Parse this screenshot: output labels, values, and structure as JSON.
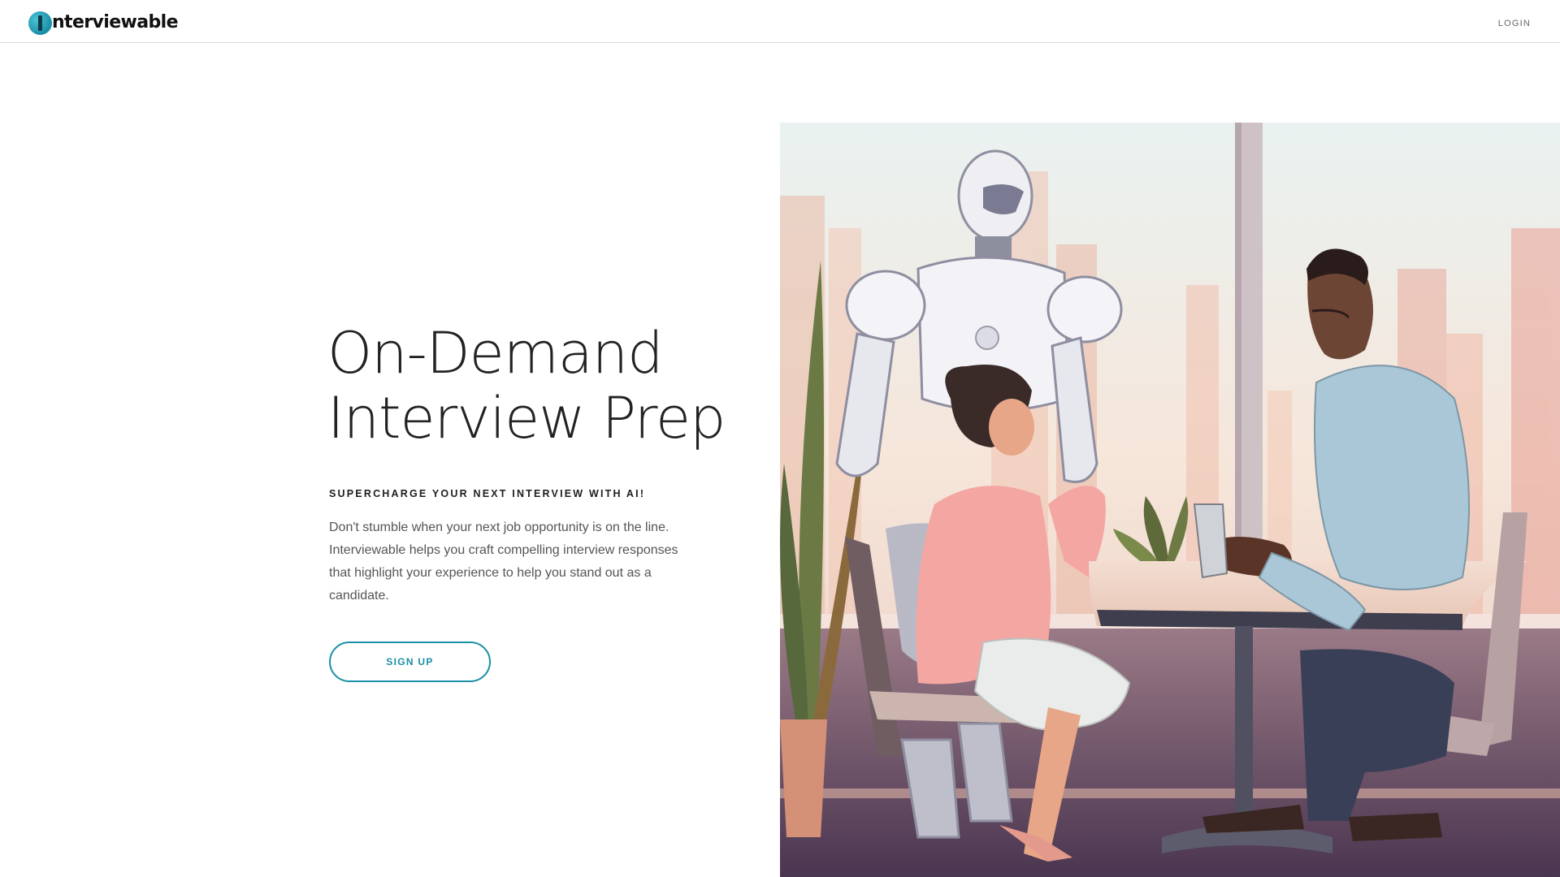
{
  "header": {
    "logo_text": "nterviewable",
    "login_label": "LOGIN"
  },
  "hero": {
    "title_line1": "On-Demand",
    "title_line2": "Interview Prep",
    "tagline": "SUPERCHARGE YOUR NEXT INTERVIEW WITH AI!",
    "description": "Don't stumble when your next job opportunity is on the line. Interviewable helps you craft compelling interview responses that highlight your experience to help you stand out as a candidate.",
    "signup_label": "SIGN UP"
  },
  "colors": {
    "accent": "#1a8fa6",
    "logo_mark": "#2aa3bb"
  },
  "icons": {
    "logo": "interviewable-logo-icon"
  }
}
